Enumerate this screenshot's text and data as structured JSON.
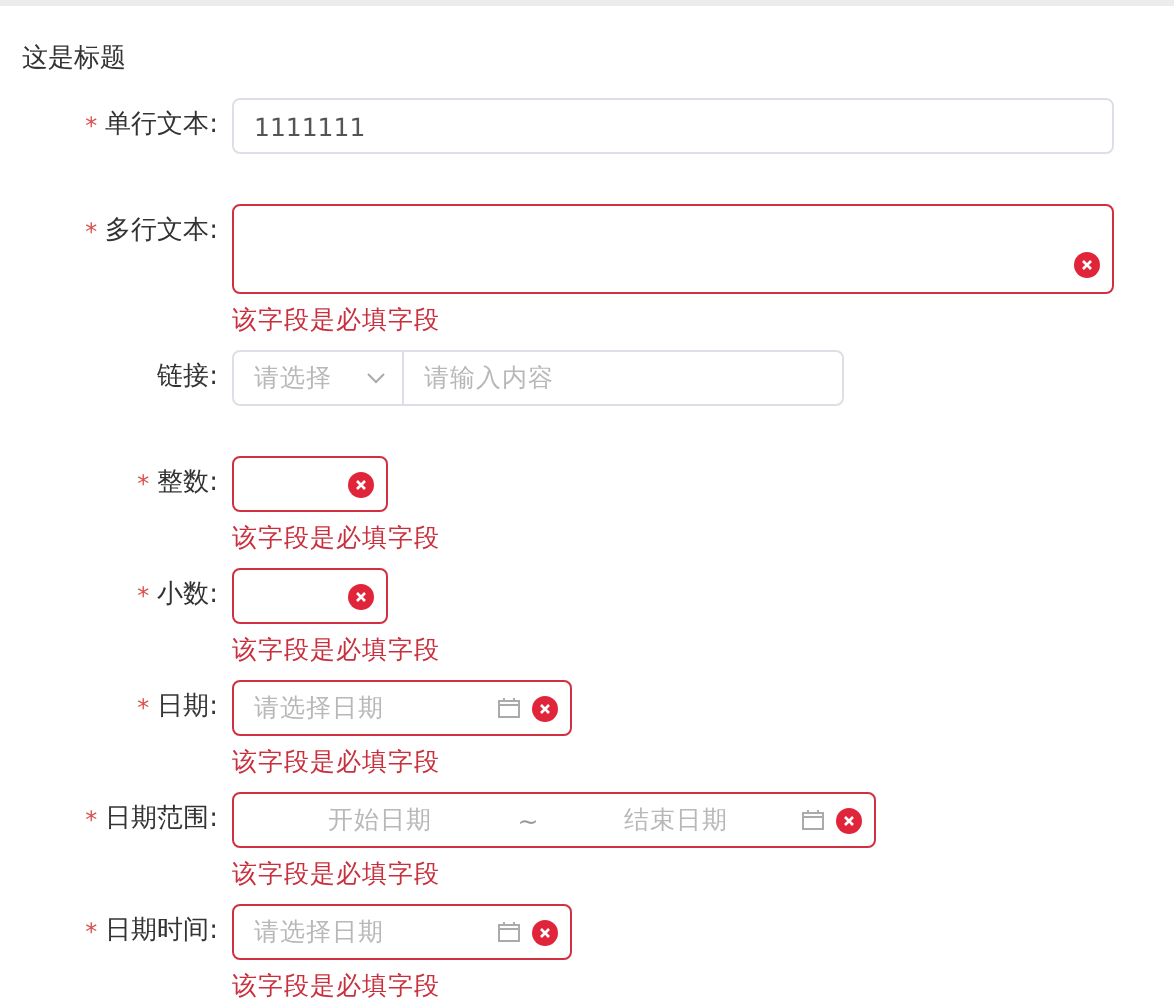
{
  "title": "这是标题",
  "required_mark": "*",
  "fields": [
    {
      "kind": "text",
      "label": "单行文本:",
      "required": true,
      "value": "1111111"
    },
    {
      "kind": "textarea",
      "label": "多行文本:",
      "required": true,
      "error": "该字段是必填字段"
    },
    {
      "kind": "link",
      "label": "链接:",
      "required": false,
      "select_placeholder": "请选择",
      "placeholder": "请输入内容"
    },
    {
      "kind": "number",
      "label": "整数:",
      "required": true,
      "error": "该字段是必填字段"
    },
    {
      "kind": "number",
      "label": "小数:",
      "required": true,
      "error": "该字段是必填字段"
    },
    {
      "kind": "date",
      "label": "日期:",
      "required": true,
      "placeholder": "请选择日期",
      "error": "该字段是必填字段"
    },
    {
      "kind": "daterange",
      "label": "日期范围:",
      "required": true,
      "start_placeholder": "开始日期",
      "separator": "~",
      "end_placeholder": "结束日期",
      "error": "该字段是必填字段"
    },
    {
      "kind": "date",
      "label": "日期时间:",
      "required": true,
      "placeholder": "请选择日期",
      "error": "该字段是必填字段"
    }
  ]
}
